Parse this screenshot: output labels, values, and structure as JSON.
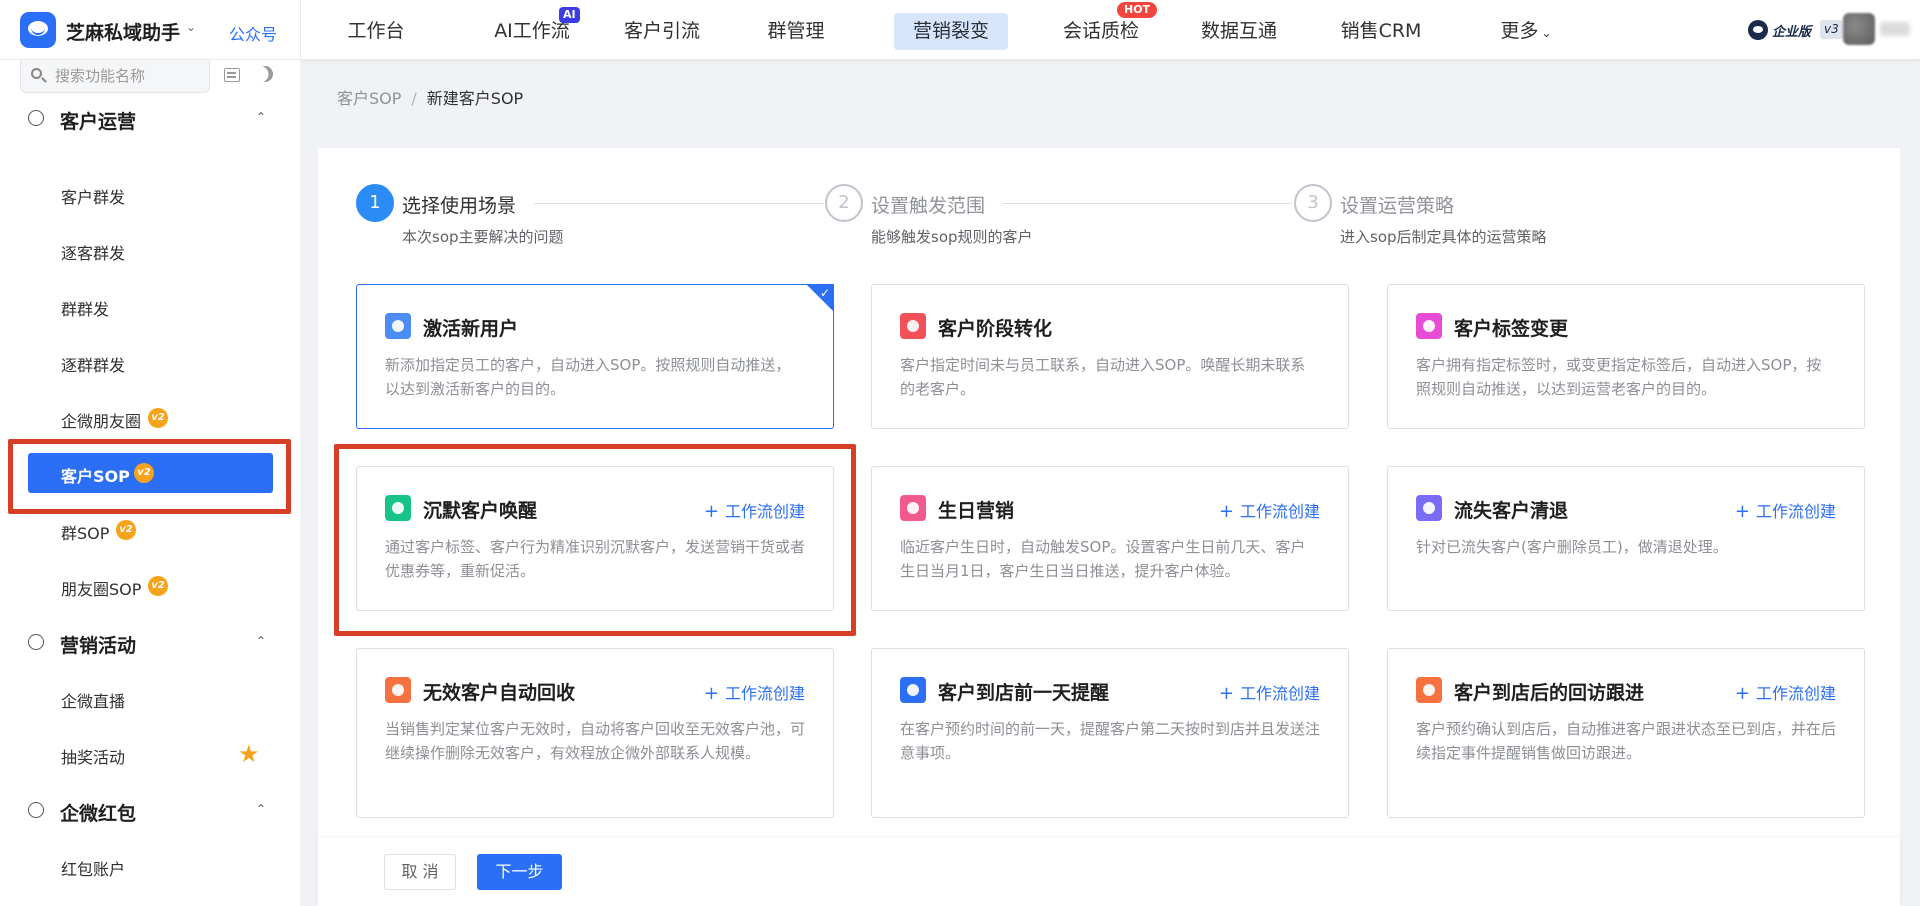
{
  "app": {
    "name": "芝麻私域助手",
    "gzh_link": "公众号"
  },
  "nav": {
    "items": [
      {
        "label": "工作台"
      },
      {
        "label": "AI工作流",
        "badge": "AI"
      },
      {
        "label": "客户引流"
      },
      {
        "label": "群管理"
      },
      {
        "label": "营销裂变",
        "active": true
      },
      {
        "label": "会话质检",
        "badge": "HOT"
      },
      {
        "label": "数据互通"
      },
      {
        "label": "销售CRM"
      },
      {
        "label": "更多"
      }
    ],
    "enterprise_label": "企业版",
    "enterprise_version": "v3"
  },
  "sidebar": {
    "search_placeholder": "搜索功能名称",
    "groups": [
      {
        "label": "客户运营",
        "items": [
          {
            "label": "客户群发"
          },
          {
            "label": "逐客群发"
          },
          {
            "label": "群群发"
          },
          {
            "label": "逐群群发"
          },
          {
            "label": "企微朋友圈",
            "badge": "v2"
          },
          {
            "label": "客户SOP",
            "badge": "v2",
            "active": true
          },
          {
            "label": "群SOP",
            "badge": "v2"
          },
          {
            "label": "朋友圈SOP",
            "badge": "v2"
          }
        ]
      },
      {
        "label": "营销活动",
        "items": [
          {
            "label": "企微直播"
          },
          {
            "label": "抽奖活动",
            "icon": "star-icon"
          }
        ]
      },
      {
        "label": "企微红包",
        "items": [
          {
            "label": "红包账户"
          }
        ]
      }
    ]
  },
  "breadcrumb": {
    "parent": "客户SOP",
    "separator": "/",
    "current": "新建客户SOP"
  },
  "steps": [
    {
      "num": "1",
      "title": "选择使用场景",
      "desc": "本次sop主要解决的问题",
      "active": true
    },
    {
      "num": "2",
      "title": "设置触发范围",
      "desc": "能够触发sop规则的客户"
    },
    {
      "num": "3",
      "title": "设置运营策略",
      "desc": "进入sop后制定具体的运营策略"
    }
  ],
  "scenarios": [
    {
      "title": "激活新用户",
      "desc": "新添加指定员工的客户，自动进入SOP。按照规则自动推送，以达到激活新客户的目的。",
      "icon_color": "#4b8cf6",
      "selected": true
    },
    {
      "title": "客户阶段转化",
      "desc": "客户指定时间未与员工联系，自动进入SOP。唤醒长期未联系的老客户。",
      "icon_color": "#f4505a"
    },
    {
      "title": "客户标签变更",
      "desc": "客户拥有指定标签时，或变更指定标签后，自动进入SOP，按照规则自动推送，以达到运营老客户的目的。",
      "icon_color": "#e84bd6"
    },
    {
      "title": "沉默客户唤醒",
      "action": "工作流创建",
      "desc": "通过客户标签、客户行为精准识别沉默客户，发送营销干货或者优惠券等，重新促活。",
      "icon_color": "#17c38a"
    },
    {
      "title": "生日营销",
      "action": "工作流创建",
      "desc": "临近客户生日时，自动触发SOP。设置客户生日前几天、客户生日当月1日，客户生日当日推送，提升客户体验。",
      "icon_color": "#f25a8e"
    },
    {
      "title": "流失客户清退",
      "action": "工作流创建",
      "desc": "针对已流失客户(客户删除员工)，做清退处理。",
      "icon_color": "#7b6cf6"
    },
    {
      "title": "无效客户自动回收",
      "action": "工作流创建",
      "desc": "当销售判定某位客户无效时，自动将客户回收至无效客户池，可继续操作删除无效客户，有效程放企微外部联系人规模。",
      "icon_color": "#f5713f"
    },
    {
      "title": "客户到店前一天提醒",
      "action": "工作流创建",
      "desc": "在客户预约时间的前一天，提醒客户第二天按时到店并且发送注意事项。",
      "icon_color": "#2b6ff6"
    },
    {
      "title": "客户到店后的回访跟进",
      "action": "工作流创建",
      "desc": "客户预约确认到店后，自动推进客户跟进状态至已到店，并在后续指定事件提醒销售做回访跟进。",
      "icon_color": "#f5713f"
    }
  ],
  "footer": {
    "cancel": "取 消",
    "next": "下一步"
  },
  "colors": {
    "primary": "#2b6ff6",
    "highlight": "#d63f26",
    "badge_gold": "#f6a31b"
  }
}
